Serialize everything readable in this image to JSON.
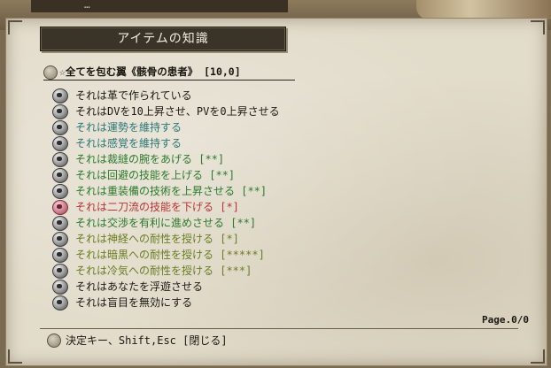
{
  "background": {
    "tab_text": "…"
  },
  "window": {
    "title": "アイテムの知識",
    "item_name": "☆全てを包む翼《骸骨の患者》 [10,0]",
    "page": "Page.0/0",
    "footer_hint": "決定キー、Shift,Esc [閉じる]"
  },
  "colors": {
    "black": "#1d1a14",
    "teal": "#2c7777",
    "green": "#2b7a2b",
    "red": "#b83333",
    "olive": "#6a7d23"
  },
  "properties": [
    {
      "text": "それは革で作られている",
      "color": "black",
      "icon": "material-icon"
    },
    {
      "text": "それはDVを10上昇させ、PVを0上昇させる",
      "color": "black",
      "icon": "armor-icon"
    },
    {
      "text": "それは運勢を維持する",
      "color": "teal",
      "icon": "luck-icon"
    },
    {
      "text": "それは感覚を維持する",
      "color": "teal",
      "icon": "perception-icon"
    },
    {
      "text": "それは裁縫の腕をあげる [**]",
      "color": "green",
      "icon": "skill-icon"
    },
    {
      "text": "それは回避の技能を上げる [**]",
      "color": "green",
      "icon": "skill-icon"
    },
    {
      "text": "それは重装備の技術を上昇させる [**]",
      "color": "green",
      "icon": "skill-icon"
    },
    {
      "text": "それは二刀流の技能を下げる [*]",
      "color": "red",
      "icon": "skill-down-icon"
    },
    {
      "text": "それは交渉を有利に進めさせる [**]",
      "color": "green",
      "icon": "skill-icon"
    },
    {
      "text": "それは神経への耐性を授ける [*]",
      "color": "olive",
      "icon": "resistance-icon"
    },
    {
      "text": "それは暗黒への耐性を授ける [*****]",
      "color": "olive",
      "icon": "resistance-icon"
    },
    {
      "text": "それは冷気への耐性を授ける [***]",
      "color": "olive",
      "icon": "resistance-icon"
    },
    {
      "text": "それはあなたを浮遊させる",
      "color": "black",
      "icon": "levitation-icon"
    },
    {
      "text": "それは盲目を無効にする",
      "color": "black",
      "icon": "blind-resist-icon"
    }
  ]
}
